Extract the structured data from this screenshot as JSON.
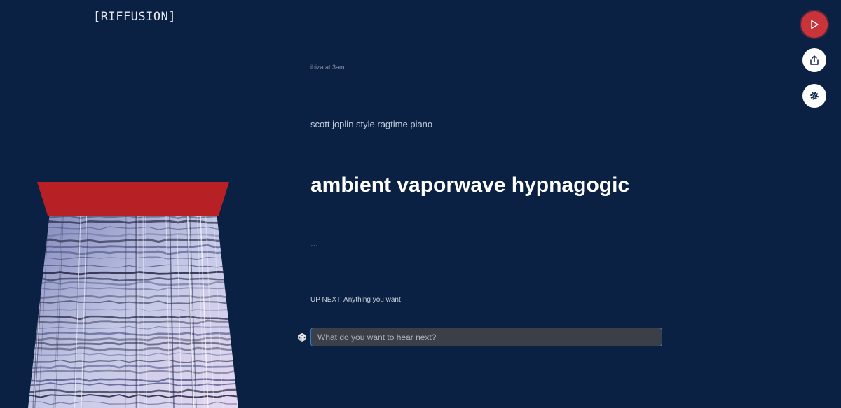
{
  "app": {
    "logo": "[RIFFUSION]"
  },
  "prompts": {
    "previous_1": "ibiza at 3am",
    "previous_2": "scott joplin style ragtime piano",
    "current": "ambient vaporwave hypnagogic",
    "next_placeholder": "..."
  },
  "up_next": {
    "label": "UP NEXT: Anything you want"
  },
  "input": {
    "placeholder": "What do you want to hear next?",
    "value": ""
  },
  "controls": {
    "play_icon": "play-icon",
    "share_icon": "share-icon",
    "settings_icon": "gear-icon",
    "dice_icon": "dice-icon"
  },
  "colors": {
    "background": "#0b2143",
    "accent_red": "#c9333a",
    "input_border": "#2b7cd0"
  }
}
